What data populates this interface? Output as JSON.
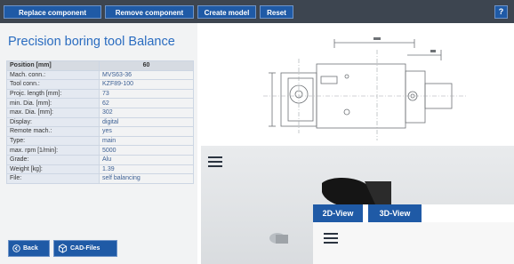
{
  "toolbar": {
    "replace_label": "Replace component",
    "remove_label": "Remove component",
    "create_model_label": "Create model",
    "reset_label": "Reset",
    "help_label": "?"
  },
  "product": {
    "title": "Precision boring tool Balance"
  },
  "spec_table": {
    "header": {
      "key": "Position [mm]",
      "value": "60"
    },
    "rows": [
      {
        "key": "Mach. conn.:",
        "value": "MVS63-36"
      },
      {
        "key": "Tool conn.:",
        "value": "KZF89-100"
      },
      {
        "key": "Projc. length [mm]:",
        "value": "73"
      },
      {
        "key": "min. Dia. [mm]:",
        "value": "62"
      },
      {
        "key": "max. Dia. [mm]:",
        "value": "302"
      },
      {
        "key": "Display:",
        "value": "digital"
      },
      {
        "key": "Remote mach.:",
        "value": "yes"
      },
      {
        "key": "Type:",
        "value": "main"
      },
      {
        "key": "max. rpm [1/min]:",
        "value": "5000"
      },
      {
        "key": "Grade:",
        "value": "Alu"
      },
      {
        "key": "Weight [kg]:",
        "value": "1.39"
      },
      {
        "key": "File:",
        "value": "self balancing"
      }
    ]
  },
  "actions": {
    "back_label": "Back",
    "cad_files_label": "CAD-Files"
  },
  "viewer": {
    "tab_2d": "2D-View",
    "tab_3d": "3D-View"
  },
  "colors": {
    "toolbar_bg": "#3d4550",
    "button_blue": "#1f5aa6",
    "title_blue": "#2a6cc0"
  }
}
